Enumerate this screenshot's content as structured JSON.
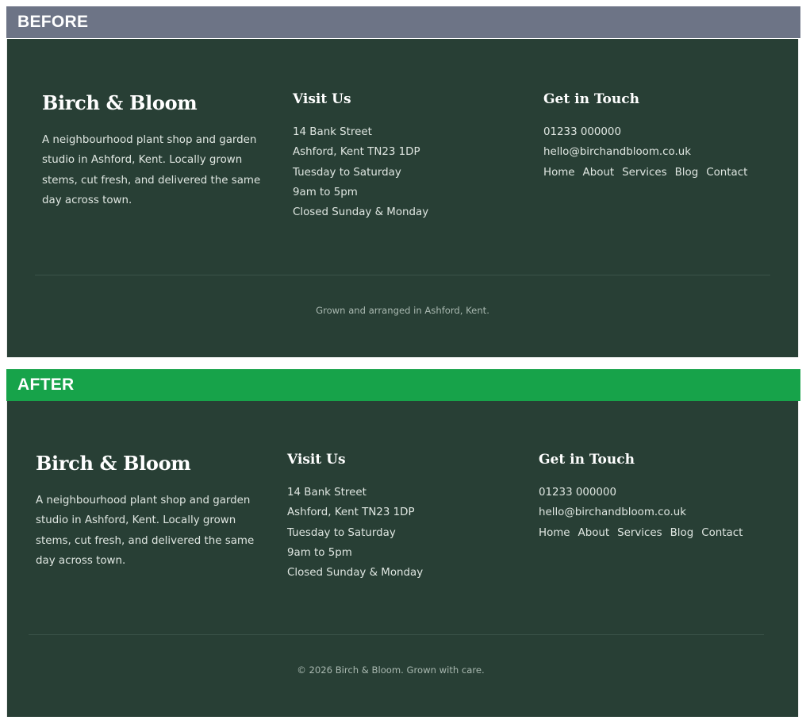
{
  "before": {
    "label": "BEFORE",
    "label_color": "#6d7486",
    "brand": "Birch & Bloom",
    "description": "A neighbourhood plant shop and garden studio in Ashford, Kent. Locally grown stems, cut fresh, and delivered the same day across town.",
    "visit": {
      "heading": "Visit Us",
      "lines": [
        "14 Bank Street",
        "Ashford, Kent TN23 1DP",
        "Tuesday to Saturday",
        "9am to 5pm",
        "Closed Sunday & Monday"
      ]
    },
    "contact": {
      "heading": "Get in Touch",
      "phone": "01233 000000",
      "email": "hello@birchandbloom.co.uk",
      "nav": [
        "Home",
        "About",
        "Services",
        "Blog",
        "Contact"
      ]
    },
    "copyright": "Grown and arranged in Ashford, Kent."
  },
  "after": {
    "label": "AFTER",
    "label_color": "#17a34a",
    "brand": "Birch & Bloom",
    "description": "A neighbourhood plant shop and garden studio in Ashford, Kent. Locally grown stems, cut fresh, and delivered the same day across town.",
    "visit": {
      "heading": "Visit Us",
      "lines": [
        "14 Bank Street",
        "Ashford, Kent TN23 1DP",
        "Tuesday to Saturday",
        "9am to 5pm",
        "Closed Sunday & Monday"
      ]
    },
    "contact": {
      "heading": "Get in Touch",
      "phone": "01233 000000",
      "email": "hello@birchandbloom.co.uk",
      "nav": [
        "Home",
        "About",
        "Services",
        "Blog",
        "Contact"
      ]
    },
    "copyright": "© 2026 Birch & Bloom. Grown with care."
  },
  "colors": {
    "footer_bg": "#283f35",
    "text_light": "#dfe6e1",
    "muted": "#a9b8b0"
  }
}
